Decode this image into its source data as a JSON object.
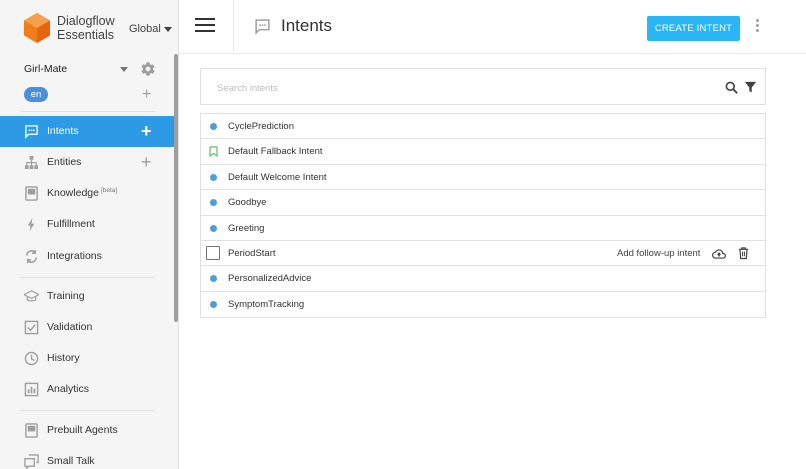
{
  "brand": {
    "name_line1": "Dialogflow",
    "name_line2": "Essentials",
    "region": "Global",
    "logo_color": "#ef7d1a"
  },
  "agent": {
    "name": "Girl-Mate",
    "language": "en"
  },
  "sidebar": {
    "items": [
      {
        "label": "Intents",
        "icon": "intents-icon",
        "active": true,
        "has_add": true
      },
      {
        "label": "Entities",
        "icon": "entities-icon",
        "has_add": true
      },
      {
        "label": "Knowledge",
        "icon": "knowledge-icon",
        "badge": "[beta]"
      },
      {
        "label": "Fulfillment",
        "icon": "fulfillment-icon"
      },
      {
        "label": "Integrations",
        "icon": "integrations-icon"
      },
      {
        "label": "Training",
        "icon": "training-icon"
      },
      {
        "label": "Validation",
        "icon": "validation-icon"
      },
      {
        "label": "History",
        "icon": "history-icon"
      },
      {
        "label": "Analytics",
        "icon": "analytics-icon"
      },
      {
        "label": "Prebuilt Agents",
        "icon": "prebuilt-agents-icon"
      },
      {
        "label": "Small Talk",
        "icon": "small-talk-icon"
      }
    ]
  },
  "header": {
    "title": "Intents",
    "create_label": "CREATE INTENT",
    "accent": "#29b6f6"
  },
  "search": {
    "placeholder": "Search intents",
    "value": ""
  },
  "intents": {
    "rows": [
      {
        "name": "CyclePrediction",
        "marker": "dot"
      },
      {
        "name": "Default Fallback Intent",
        "marker": "bookmark"
      },
      {
        "name": "Default Welcome Intent",
        "marker": "dot"
      },
      {
        "name": "Goodbye",
        "marker": "dot"
      },
      {
        "name": "Greeting",
        "marker": "dot"
      },
      {
        "name": "PeriodStart",
        "marker": "checkbox",
        "hovered": true
      },
      {
        "name": "PersonalizedAdvice",
        "marker": "dot"
      },
      {
        "name": "SymptomTracking",
        "marker": "dot"
      }
    ],
    "followup_label": "Add follow-up intent"
  },
  "colors": {
    "active_nav": "#2d9ae6",
    "intent_dot": "#4a9fd8"
  }
}
